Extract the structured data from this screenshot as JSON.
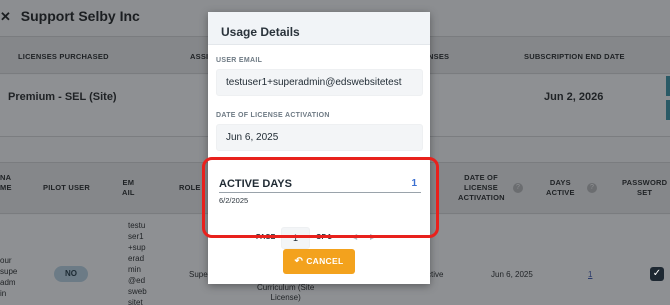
{
  "background": {
    "page_title": "Support Selby Inc",
    "licenses_table": {
      "headers": [
        "LICENSES PURCHASED",
        "ASSI",
        "NSES",
        "SUBSCRIPTION END DATE"
      ],
      "row": {
        "license_name": "Premium - SEL (Site)",
        "end_date": "Jun 2, 2026"
      }
    },
    "users_table": {
      "headers": {
        "name": "NA\nME",
        "pilot": "PILOT USER",
        "email": "EM\nAIL",
        "role": "ROLE",
        "activation": "DATE OF\nLICENSE\nACTIVATION",
        "days": "DAYS\nACTIVE",
        "password": "PASSWORD\nSET"
      },
      "row": {
        "name": "our\nsupe\nadm\nin",
        "pilot": "NO",
        "email": "testu\nser1\n+sup\nerad\nmin\n@ed\nsweb\nsitet",
        "role": "Super",
        "curriculum": "Curriculum (Site\nLicense)",
        "status": "ctive",
        "activation": "Jun 6, 2025",
        "days": "1",
        "password_check": "✓"
      }
    }
  },
  "modal": {
    "title": "Usage Details",
    "user_email_label": "USER EMAIL",
    "user_email_value": "testuser1+superadmin@edswebsitetest",
    "activation_label": "DATE OF LICENSE ACTIVATION",
    "activation_value": "Jun 6, 2025",
    "active_days": {
      "title": "ACTIVE DAYS",
      "count": "1",
      "dates": [
        "6/2/2025"
      ]
    },
    "pager": {
      "page_label": "PAGE",
      "page_value": "1",
      "of_label": "OF 1",
      "prev_icon": "◀",
      "next_icon": "▶"
    },
    "cancel_label": "CANCEL"
  },
  "annotation": {
    "highlight_color": "#e8211c"
  },
  "colors": {
    "accent": "#f3a21d",
    "count_blue": "#3b6fd1"
  }
}
